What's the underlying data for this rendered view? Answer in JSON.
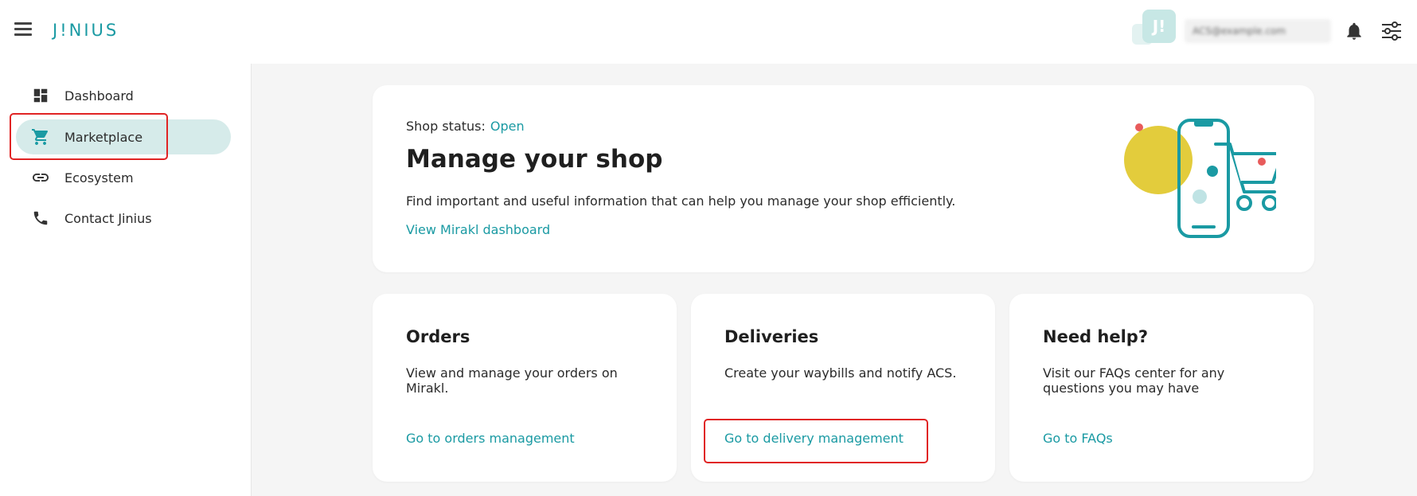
{
  "header": {
    "logo": "J!NIUS",
    "avatar_initials": "J!",
    "user_email": "ACS@example.com"
  },
  "sidebar": {
    "items": [
      {
        "label": "Dashboard",
        "icon": "dashboard-icon"
      },
      {
        "label": "Marketplace",
        "icon": "cart-icon",
        "active": true
      },
      {
        "label": "Ecosystem",
        "icon": "link-icon"
      },
      {
        "label": "Contact Jinius",
        "icon": "phone-icon"
      }
    ]
  },
  "hero": {
    "status_label": "Shop status:",
    "status_value": "Open",
    "title": "Manage your shop",
    "description": "Find important and useful information that can help you manage your shop efficiently.",
    "link": "View Mirakl dashboard"
  },
  "cards": [
    {
      "title": "Orders",
      "description": "View and manage your orders on Mirakl.",
      "link": "Go to orders management"
    },
    {
      "title": "Deliveries",
      "description": "Create your waybills and notify ACS.",
      "link": "Go to delivery management"
    },
    {
      "title": "Need help?",
      "description": "Visit our FAQs center for any questions you may have",
      "link": "Go to FAQs"
    }
  ],
  "colors": {
    "accent": "#1a9aa3",
    "active_nav": "#d6ebea",
    "highlight": "#e02424",
    "illustration_yellow": "#e3cc3c",
    "illustration_red": "#e85b5b"
  }
}
